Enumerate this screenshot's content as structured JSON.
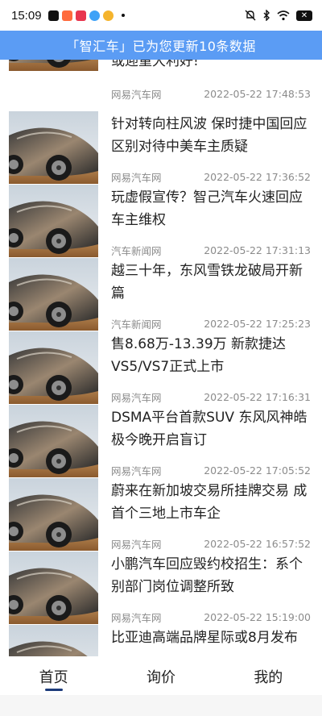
{
  "status_bar": {
    "time": "15:09",
    "battery": "✕",
    "icons": [
      "tiktok-icon",
      "photo-icon",
      "video-icon",
      "camera-icon",
      "weibo-icon",
      "mute-icon",
      "bluetooth-icon",
      "wifi-icon",
      "battery-icon"
    ]
  },
  "banner": {
    "text": "「智汇车」已为您更新10条数据"
  },
  "colors": {
    "banner": "#5b9cf4",
    "nav_underline": "#1c3b7a",
    "meta_text": "#8b8b8b"
  },
  "news": [
    {
      "title": "或迎重大利好!",
      "source": "网易汽车网",
      "time": "2022-05-22 17:48:53"
    },
    {
      "title": "针对转向柱风波 保时捷中国回应区别对待中美车主质疑",
      "source": "网易汽车网",
      "time": "2022-05-22 17:36:52"
    },
    {
      "title": "玩虚假宣传？智己汽车火速回应车主维权",
      "source": "汽车新闻网",
      "time": "2022-05-22 17:31:13"
    },
    {
      "title": "越三十年，东风雪铁龙破局开新篇",
      "source": "汽车新闻网",
      "time": "2022-05-22 17:25:23"
    },
    {
      "title": "售8.68万-13.39万 新款捷达VS5/VS7正式上市",
      "source": "网易汽车网",
      "time": "2022-05-22 17:16:31"
    },
    {
      "title": "DSMA平台首款SUV 东风风神皓极今晚开启盲订",
      "source": "网易汽车网",
      "time": "2022-05-22 17:05:52"
    },
    {
      "title": "蔚来在新加坡交易所挂牌交易 成首个三地上市车企",
      "source": "网易汽车网",
      "time": "2022-05-22 16:57:52"
    },
    {
      "title": "小鹏汽车回应毁约校招生：系个别部门岗位调整所致",
      "source": "网易汽车网",
      "time": "2022-05-22 15:19:00"
    },
    {
      "title": "比亚迪高端品牌星际或8月发布",
      "source": "",
      "time": ""
    }
  ],
  "nav": [
    {
      "label": "首页",
      "active": true
    },
    {
      "label": "询价",
      "active": false
    },
    {
      "label": "我的",
      "active": false
    }
  ]
}
